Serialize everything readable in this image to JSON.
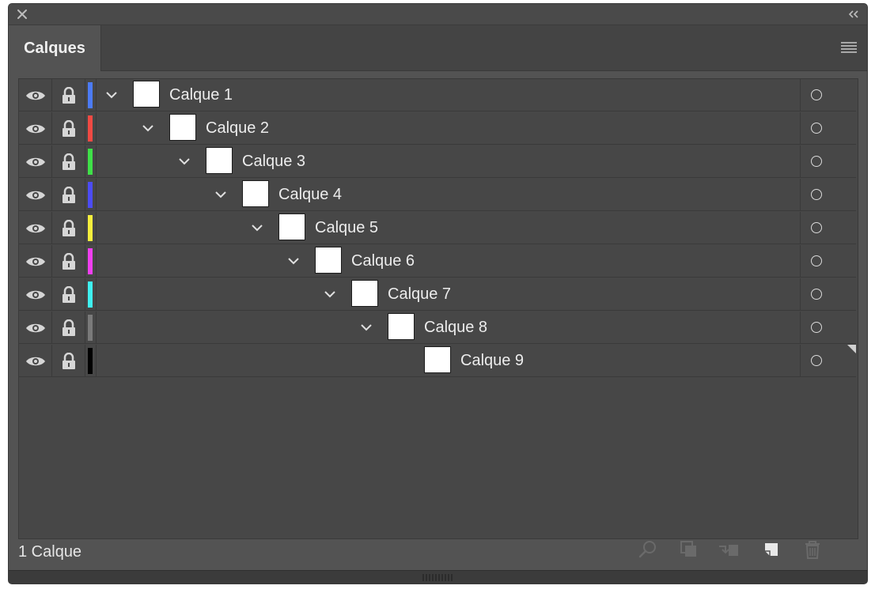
{
  "panel": {
    "tab_label": "Calques",
    "footer_status": "1 Calque"
  },
  "layers": [
    {
      "name": "Calque 1",
      "color": "#4c7bf5",
      "depth": 0,
      "expandable": true
    },
    {
      "name": "Calque 2",
      "color": "#f04a43",
      "depth": 1,
      "expandable": true
    },
    {
      "name": "Calque 3",
      "color": "#3fe048",
      "depth": 2,
      "expandable": true
    },
    {
      "name": "Calque 4",
      "color": "#4c4cf5",
      "depth": 3,
      "expandable": true
    },
    {
      "name": "Calque 5",
      "color": "#f5ee3d",
      "depth": 4,
      "expandable": true
    },
    {
      "name": "Calque 6",
      "color": "#f03ff0",
      "depth": 5,
      "expandable": true
    },
    {
      "name": "Calque 7",
      "color": "#3ff0f0",
      "depth": 6,
      "expandable": true
    },
    {
      "name": "Calque 8",
      "color": "#7a7a7a",
      "depth": 7,
      "expandable": true
    },
    {
      "name": "Calque 9",
      "color": "#000000",
      "depth": 8,
      "expandable": false
    }
  ],
  "footer_icons": [
    "search-icon",
    "clipping-mask-icon",
    "move-to-layer-icon",
    "new-layer-icon",
    "trash-icon"
  ]
}
